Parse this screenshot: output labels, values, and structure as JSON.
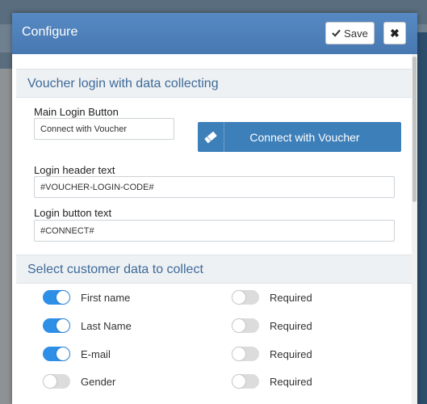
{
  "modal": {
    "title": "Configure",
    "save_label": "Save",
    "close_symbol": "✖"
  },
  "voucher_section": {
    "heading": "Voucher login with data collecting",
    "main_login_button_label": "Main Login Button",
    "main_login_button_value": "Connect with Voucher",
    "preview_button_label": "Connect with Voucher",
    "preview_button_icon": "ticket-icon",
    "login_header_label": "Login header text",
    "login_header_value": "#VOUCHER-LOGIN-CODE#",
    "login_button_label": "Login button text",
    "login_button_value": "#CONNECT#"
  },
  "customer_section": {
    "heading": "Select customer data to collect",
    "fields": [
      {
        "label": "First name",
        "collect": true,
        "required_label": "Required",
        "required": false
      },
      {
        "label": "Last Name",
        "collect": true,
        "required_label": "Required",
        "required": false
      },
      {
        "label": "E-mail",
        "collect": true,
        "required_label": "Required",
        "required": false
      },
      {
        "label": "Gender",
        "collect": false,
        "required_label": "Required",
        "required": false
      }
    ]
  },
  "colors": {
    "header": "#4f82bb",
    "accent": "#3d7fb9",
    "toggle_on": "#2e8fe6",
    "toggle_off": "#dcdcdc",
    "section_heading": "#3d6a98"
  }
}
